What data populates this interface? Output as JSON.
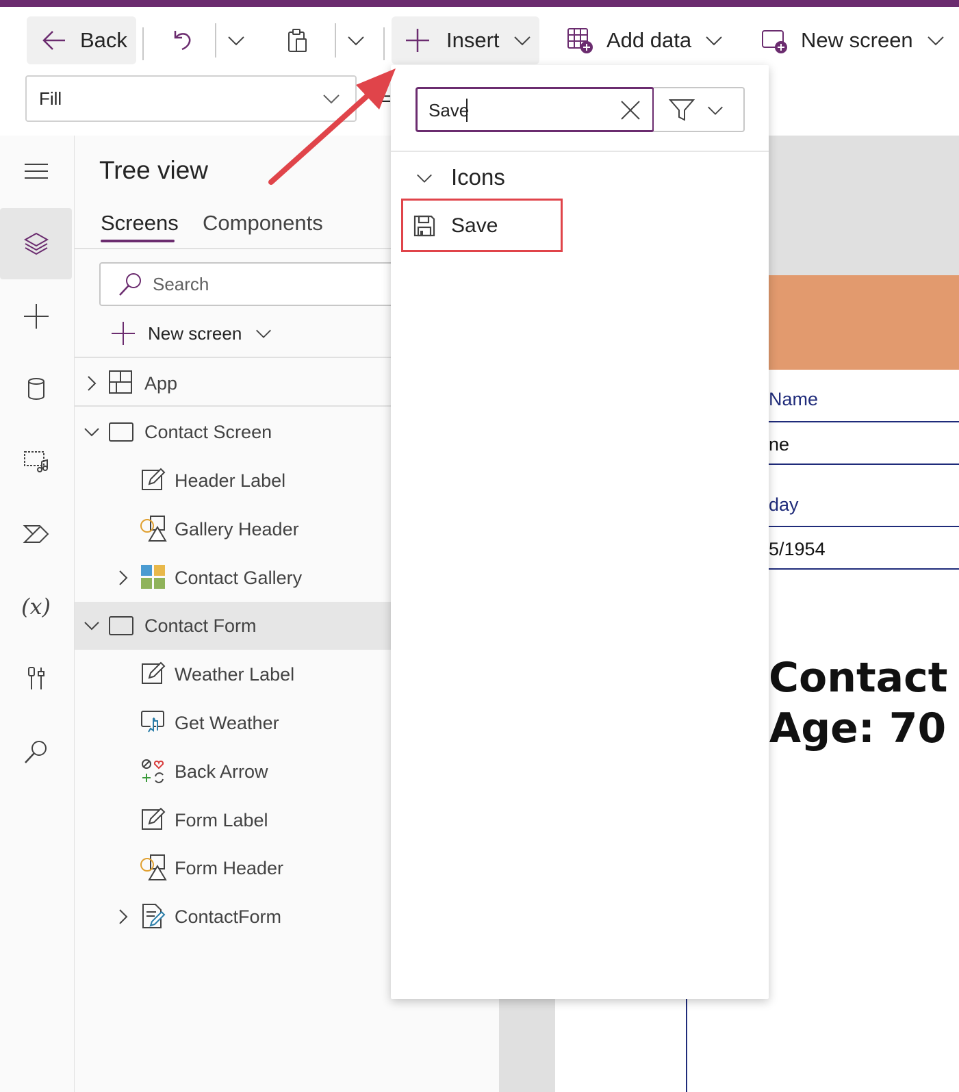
{
  "toolbar": {
    "back_label": "Back",
    "insert_label": "Insert",
    "add_data_label": "Add data",
    "new_screen_label": "New screen"
  },
  "formula_bar": {
    "property_value": "Fill",
    "equals_sign": "="
  },
  "tree_view": {
    "title": "Tree view",
    "tabs": [
      "Screens",
      "Components"
    ],
    "search_placeholder": "Search",
    "new_screen_label": "New screen",
    "items": [
      {
        "label": "App"
      },
      {
        "label": "Contact Screen"
      },
      {
        "label": "Header Label"
      },
      {
        "label": "Gallery Header"
      },
      {
        "label": "Contact Gallery"
      },
      {
        "label": "Contact Form"
      },
      {
        "label": "Weather Label"
      },
      {
        "label": "Get Weather"
      },
      {
        "label": "Back Arrow"
      },
      {
        "label": "Form Label"
      },
      {
        "label": "Form Header"
      },
      {
        "label": "ContactForm"
      }
    ],
    "selected_item": "Contact Form"
  },
  "insert_panel": {
    "search_value": "Save",
    "category_heading": "Icons",
    "results": [
      {
        "label": "Save",
        "icon": "save-icon"
      }
    ]
  },
  "canvas": {
    "field_label_1": "Name",
    "field_value_1": "ne",
    "field_label_2": "day",
    "field_value_2": "5/1954",
    "title_line_1": "Contact",
    "title_line_2": "Age: 70"
  },
  "colors": {
    "accent": "#6b2c6f",
    "header_band": "#e29a6e",
    "form_line": "#1f2b7a",
    "annotation": "#e0444a"
  }
}
